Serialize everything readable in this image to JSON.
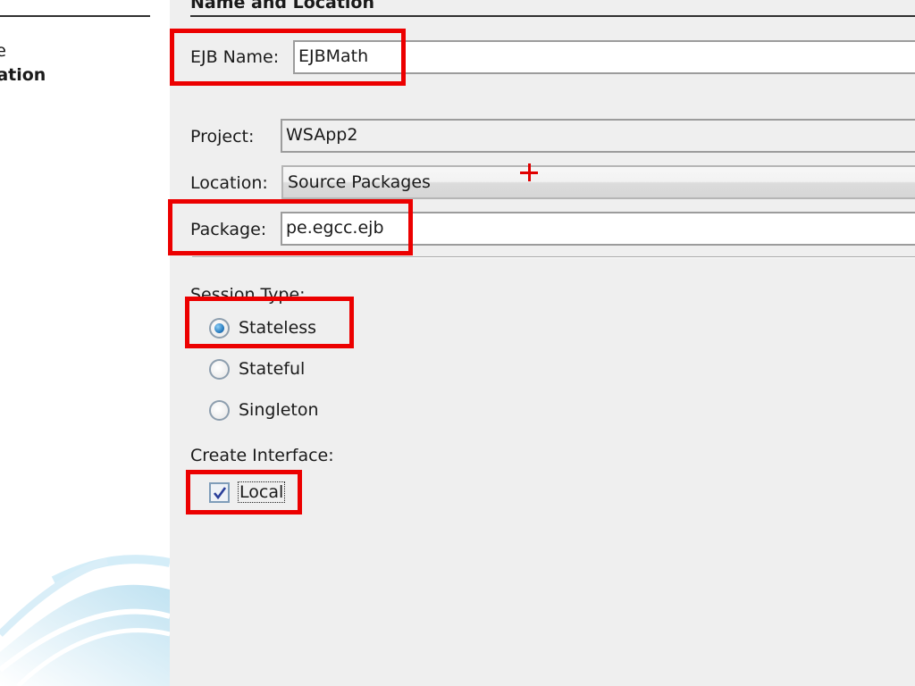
{
  "steps": {
    "items": [
      {
        "label": "ype",
        "active": false
      },
      {
        "label": "ocation",
        "active": true
      }
    ]
  },
  "section": {
    "title": "Name and Location"
  },
  "form": {
    "ejb_name": {
      "label": "EJB Name:",
      "value": "EJBMath"
    },
    "project": {
      "label": "Project:",
      "value": "WSApp2"
    },
    "location": {
      "label": "Location:",
      "value": "Source Packages"
    },
    "package": {
      "label": "Package:",
      "value": "pe.egcc.ejb"
    }
  },
  "session_type": {
    "label": "Session Type:",
    "options": [
      {
        "label": "Stateless",
        "selected": true
      },
      {
        "label": "Stateful",
        "selected": false
      },
      {
        "label": "Singleton",
        "selected": false
      }
    ]
  },
  "create_interface": {
    "label": "Create Interface:",
    "options": [
      {
        "label": "Local",
        "checked": true
      }
    ]
  },
  "colors": {
    "highlight": "#ec0000",
    "panel_bg": "#efefef",
    "steps_bg": "#ffffff",
    "radio_selected": "#2b7fc2"
  },
  "icons": {
    "annotation_marker": "crosshair-plus-icon",
    "brand_graphic": "swoosh-logo-icon"
  }
}
